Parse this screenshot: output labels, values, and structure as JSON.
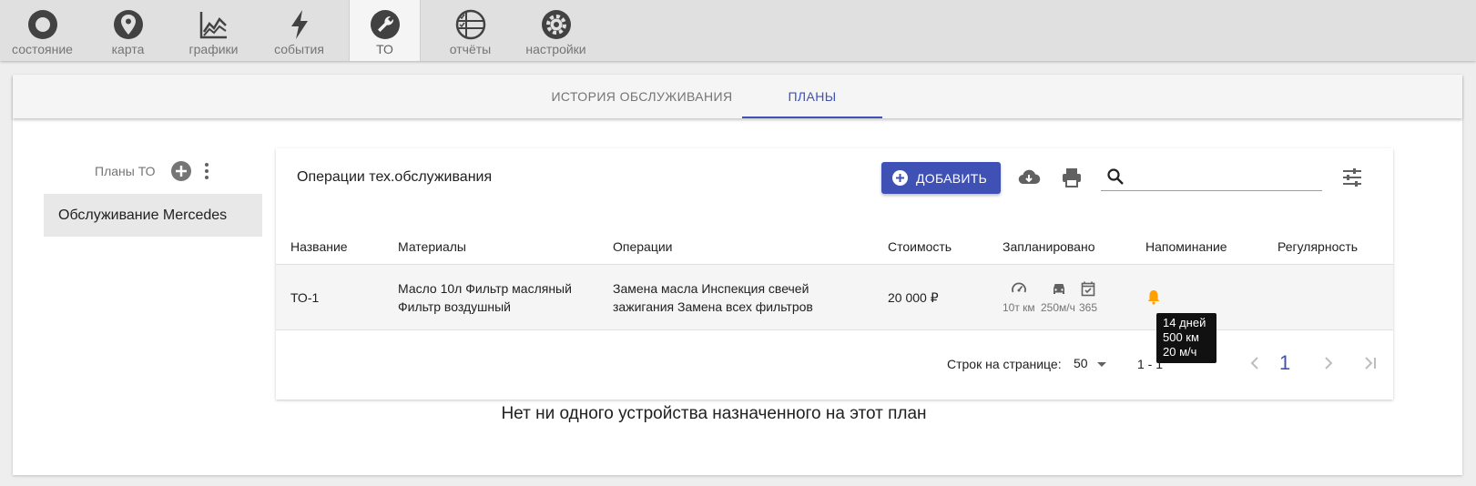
{
  "nav": {
    "items": [
      {
        "label": "состояние",
        "icon": "circle-status-icon"
      },
      {
        "label": "карта",
        "icon": "map-pin-icon"
      },
      {
        "label": "графики",
        "icon": "chart-icon"
      },
      {
        "label": "события",
        "icon": "lightning-icon"
      },
      {
        "label": "ТО",
        "icon": "wrench-icon",
        "active": true
      },
      {
        "label": "отчёты",
        "icon": "report-checklist-icon"
      },
      {
        "label": "настройки",
        "icon": "gear-icon"
      }
    ]
  },
  "subtabs": {
    "history": "ИСТОРИЯ ОБСЛУЖИВАНИЯ",
    "plans": "ПЛАНЫ",
    "active": "plans"
  },
  "sidebar": {
    "title": "Планы ТО",
    "items": [
      {
        "label": "Обслуживание Mercedes"
      }
    ]
  },
  "panel": {
    "title": "Операции тех.обслуживания",
    "add_label": "ДОБАВИТЬ",
    "search": {
      "value": "",
      "placeholder": ""
    }
  },
  "table": {
    "headers": [
      "Название",
      "Материалы",
      "Операции",
      "Стоимость",
      "Запланировано",
      "Напоминание",
      "Регулярность"
    ],
    "rows": [
      {
        "name": "ТО-1",
        "materials": "Масло 10л Фильтр масляный Фильтр воздушный",
        "operations": "Замена масла Инспекция свечей зажигания Замена всех фильтров",
        "cost": "20 000 ₽",
        "scheduled": {
          "mileage": "10т км",
          "hours": "250м/ч",
          "days": "365"
        }
      }
    ]
  },
  "pagination": {
    "rows_label": "Строк на странице:",
    "rows_value": "50",
    "range": "1 - 1",
    "current_page": "1"
  },
  "empty_message": "Нет ни одного устройства назначенного на этот план",
  "tooltip": {
    "lines": [
      "14 дней",
      "500 км",
      "20 м/ч"
    ]
  },
  "colors": {
    "accent": "#3f51b5",
    "reminder": "#ffa000",
    "icon": "#424242"
  }
}
